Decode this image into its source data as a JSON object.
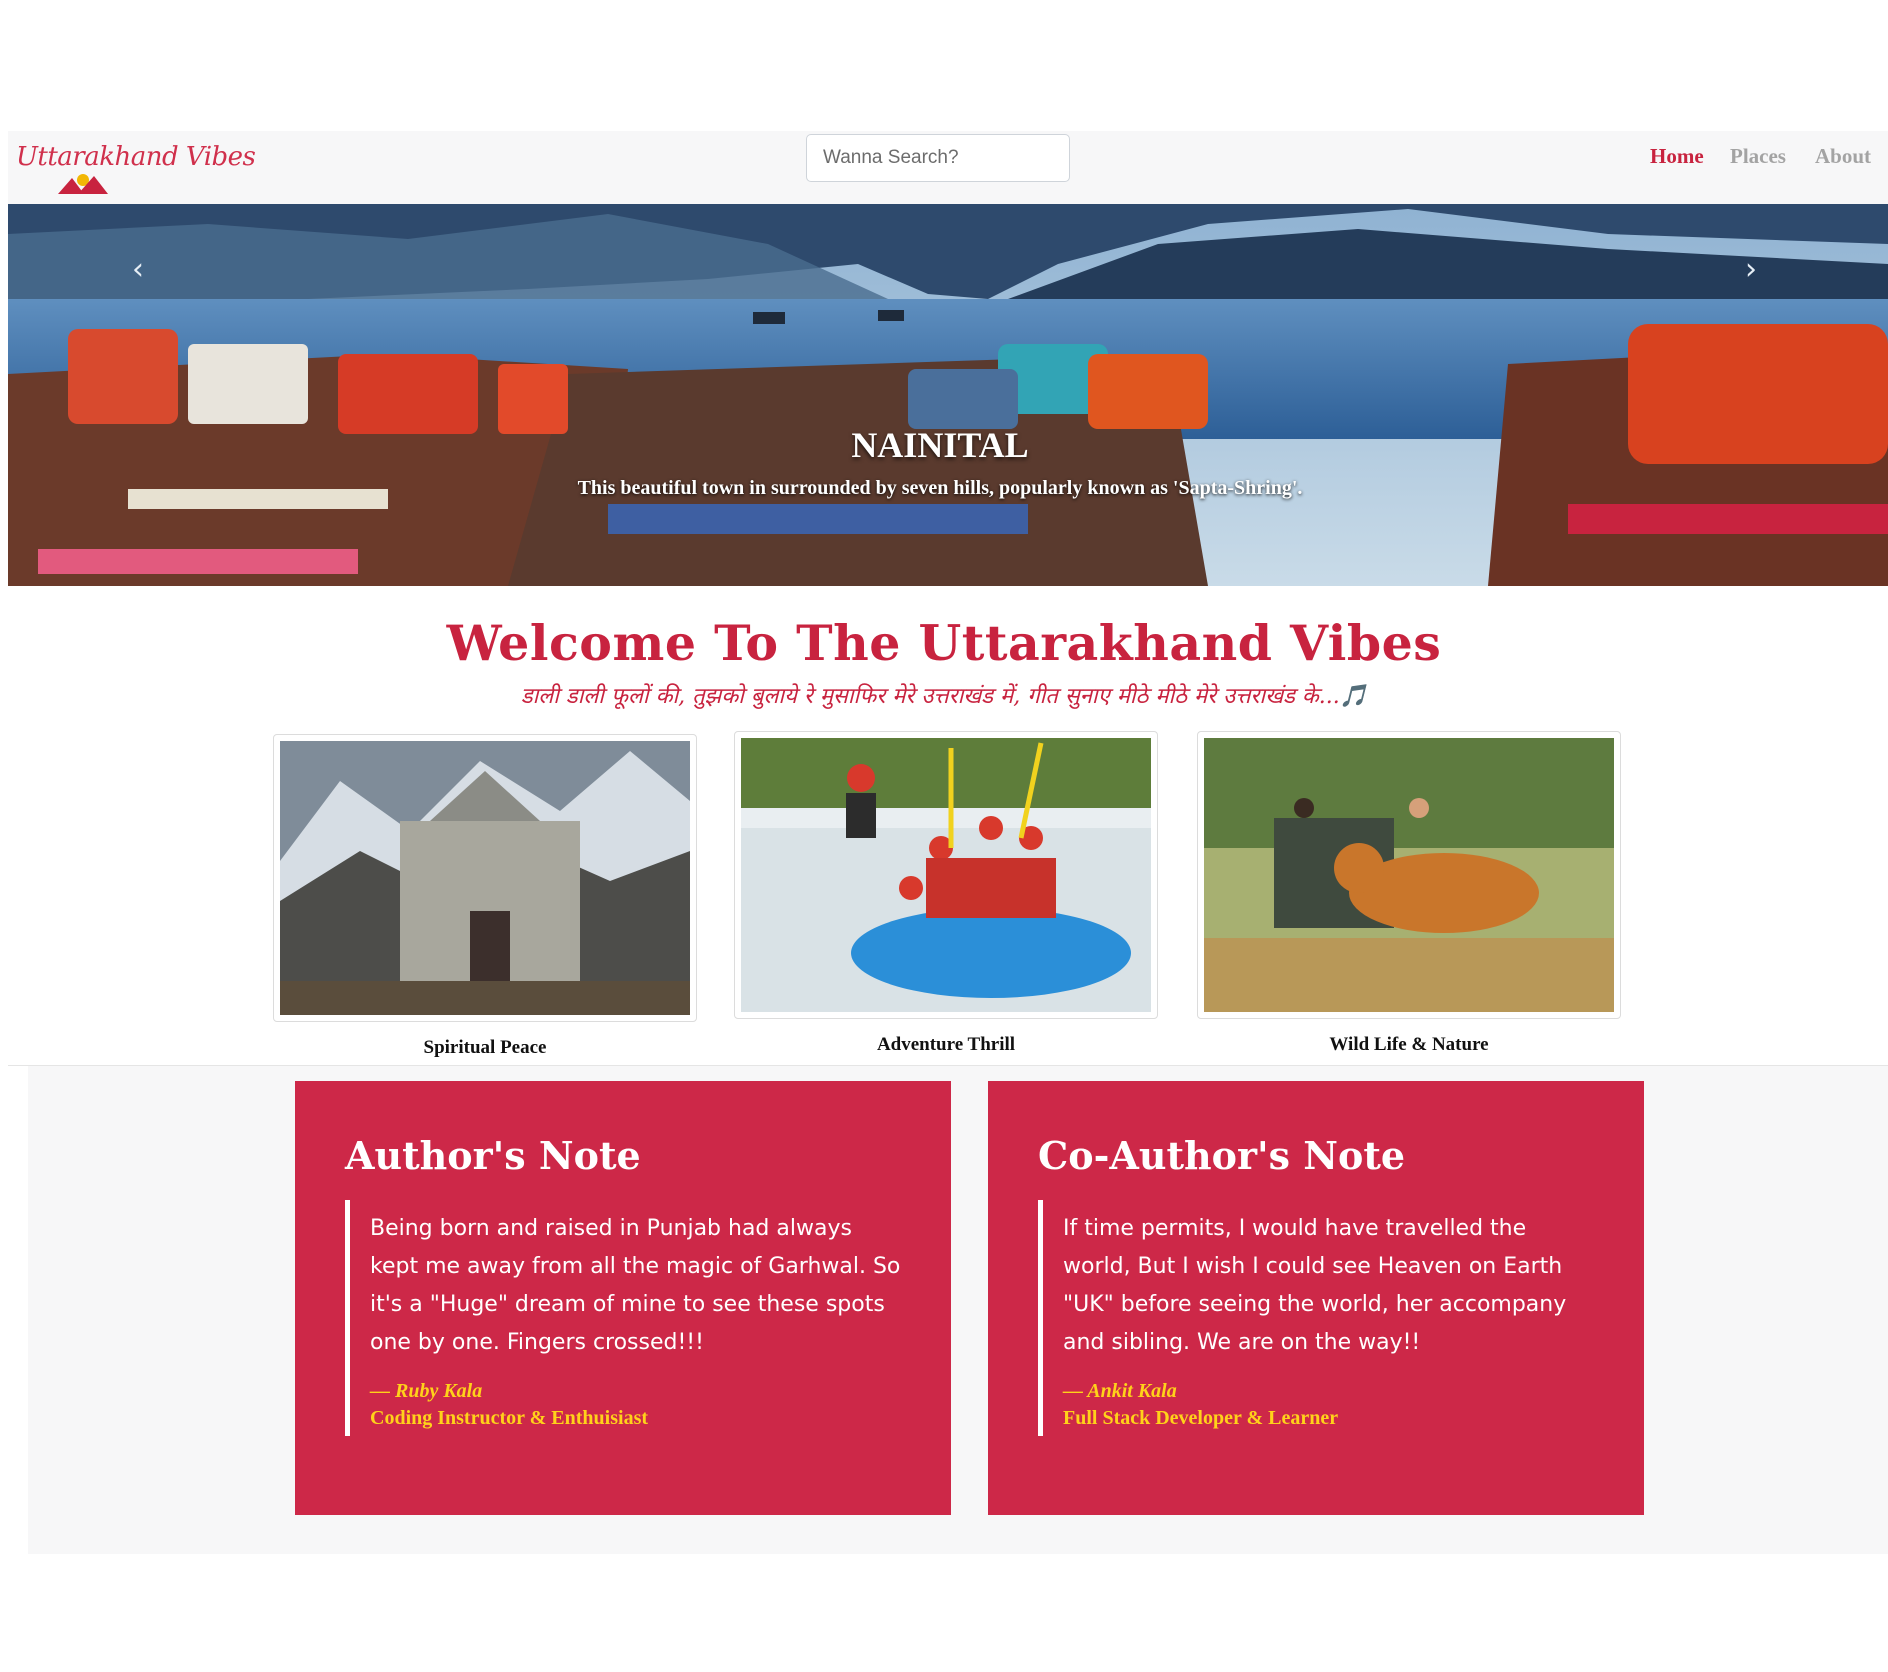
{
  "navbar": {
    "logo_text": "Uttarakhand Vibes",
    "search_placeholder": "Wanna Search?",
    "links": [
      {
        "label": "Home",
        "active": true
      },
      {
        "label": "Places",
        "active": false
      },
      {
        "label": "About",
        "active": false
      }
    ]
  },
  "hero": {
    "title": "NAINITAL",
    "subtitle": "This beautiful town in surrounded by seven hills, popularly known as 'Sapta-Shring'.",
    "prev_icon": "chevron-left-icon",
    "next_icon": "chevron-right-icon"
  },
  "welcome": {
    "title": "Welcome To The Uttarakhand Vibes",
    "tagline": "डाली डाली फूलों की, तुझको बुलाये रे मुसाफिर मेरे उत्तराखंड में, गीत सुनाए मीठे मीठे मेरे उत्तराखंड के...🎵"
  },
  "cards": [
    {
      "caption": "Spiritual Peace"
    },
    {
      "caption": "Adventure Thrill"
    },
    {
      "caption": "Wild Life & Nature"
    }
  ],
  "notes": [
    {
      "heading": "Author's Note",
      "body": "Being born and raised in Punjab had always kept me away from all the magic of Garhwal. So it's a \"Huge\" dream of mine to see these spots one by one. Fingers crossed!!!",
      "signature": "— Ruby Kala",
      "role": "Coding Instructor & Enthuisiast"
    },
    {
      "heading": "Co-Author's Note",
      "body": "If time permits, I would have travelled the world, But I wish I could see Heaven on Earth \"UK\" before seeing the world, her accompany and sibling. We are on the way!!",
      "signature": "— Ankit Kala",
      "role": "Full Stack Developer & Learner"
    }
  ],
  "colors": {
    "brand": "#c8233f",
    "note_bg": "#cd2848",
    "signature": "#ffd21a",
    "nav_inactive": "#a3a3a3"
  }
}
